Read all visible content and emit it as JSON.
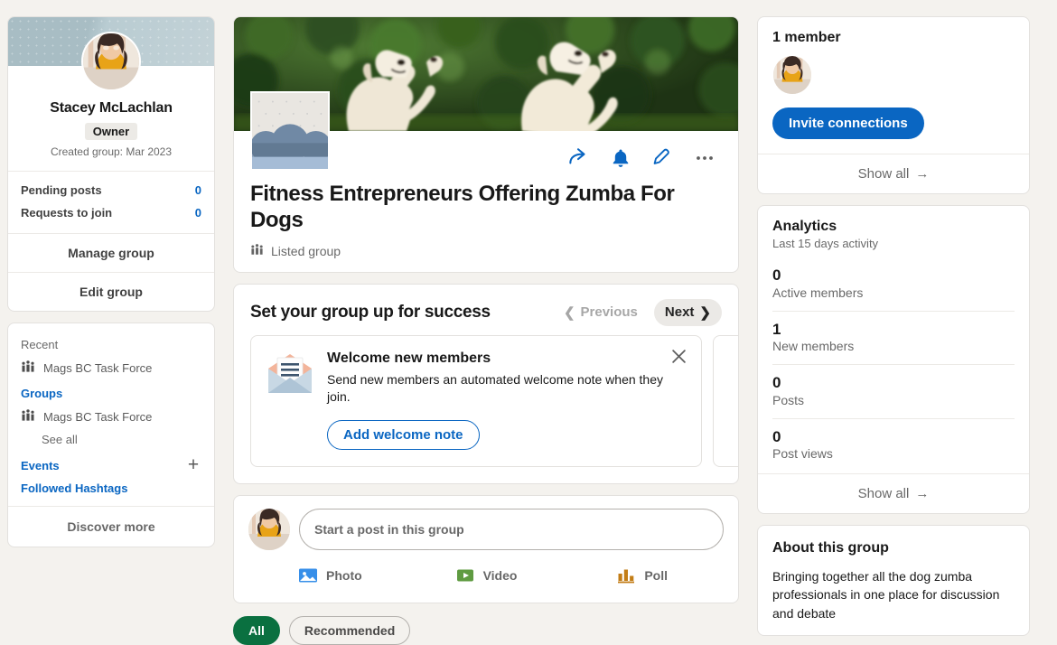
{
  "left_sidebar": {
    "profile": {
      "name": "Stacey McLachlan",
      "role_badge": "Owner",
      "created": "Created group: Mar 2023",
      "stats": [
        {
          "label": "Pending posts",
          "value": "0"
        },
        {
          "label": "Requests to join",
          "value": "0"
        }
      ],
      "manage_label": "Manage group",
      "edit_label": "Edit group"
    },
    "nav": {
      "recent_label": "Recent",
      "recent_items": [
        {
          "label": "Mags BC Task Force"
        }
      ],
      "groups_label": "Groups",
      "group_items": [
        {
          "label": "Mags BC Task Force"
        }
      ],
      "see_all_label": "See all",
      "events_label": "Events",
      "hashtags_label": "Followed Hashtags",
      "discover_label": "Discover more"
    }
  },
  "group": {
    "title": "Fitness Entrepreneurs Offering Zumba For Dogs",
    "visibility": "Listed group",
    "actions": [
      {
        "name": "share-icon"
      },
      {
        "name": "bell-icon"
      },
      {
        "name": "pencil-icon"
      },
      {
        "name": "more-options-icon"
      }
    ]
  },
  "success": {
    "title": "Set your group up for success",
    "previous_label": "Previous",
    "next_label": "Next",
    "slide": {
      "title": "Welcome new members",
      "text": "Send new members an automated welcome note when they join.",
      "button_label": "Add welcome note"
    }
  },
  "composer": {
    "placeholder": "Start a post in this group",
    "actions": [
      {
        "label": "Photo",
        "icon": "photo-icon",
        "color": "#378fe9"
      },
      {
        "label": "Video",
        "icon": "video-icon",
        "color": "#5f9b41"
      },
      {
        "label": "Poll",
        "icon": "poll-icon",
        "color": "#c37d16"
      }
    ]
  },
  "filters": [
    {
      "label": "All",
      "active": true
    },
    {
      "label": "Recommended",
      "active": false
    }
  ],
  "members": {
    "count_label": "1 member",
    "invite_label": "Invite connections",
    "show_all_label": "Show all"
  },
  "analytics": {
    "title": "Analytics",
    "subtitle": "Last 15 days activity",
    "items": [
      {
        "value": "0",
        "label": "Active members"
      },
      {
        "value": "1",
        "label": "New members"
      },
      {
        "value": "0",
        "label": "Posts"
      },
      {
        "value": "0",
        "label": "Post views"
      }
    ],
    "show_all_label": "Show all"
  },
  "about": {
    "title": "About this group",
    "text": "Bringing together all the dog zumba professionals in one place for discussion and debate"
  },
  "colors": {
    "accent_blue": "#0a66c2",
    "green_pill": "#0a7040",
    "page_bg": "#f4f2ee"
  }
}
